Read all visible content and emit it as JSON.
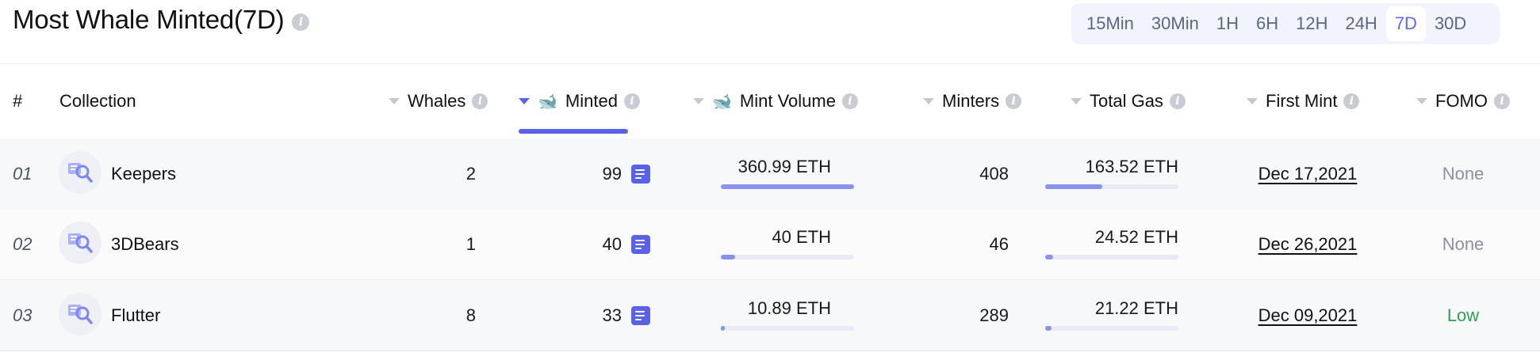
{
  "title": "Most Whale Minted(7D)",
  "time_filters": [
    "15Min",
    "30Min",
    "1H",
    "6H",
    "12H",
    "24H",
    "7D",
    "30D"
  ],
  "active_time_filter": "7D",
  "columns": {
    "rank": "#",
    "collection": "Collection",
    "whales": "Whales",
    "minted": "Minted",
    "mint_volume": "Mint Volume",
    "minters": "Minters",
    "total_gas": "Total Gas",
    "first_mint": "First Mint",
    "fomo": "FOMO"
  },
  "sorted_column": "Minted",
  "rows": [
    {
      "rank": "01",
      "collection": "Keepers",
      "whales": "2",
      "minted": "99",
      "mint_volume": "360.99 ETH",
      "mint_volume_fill": 1.0,
      "minters": "408",
      "total_gas": "163.52 ETH",
      "total_gas_fill": 0.43,
      "first_mint": "Dec 17,2021",
      "fomo": "None"
    },
    {
      "rank": "02",
      "collection": "3DBears",
      "whales": "1",
      "minted": "40",
      "mint_volume": "40 ETH",
      "mint_volume_fill": 0.11,
      "minters": "46",
      "total_gas": "24.52 ETH",
      "total_gas_fill": 0.06,
      "first_mint": "Dec 26,2021",
      "fomo": "None"
    },
    {
      "rank": "03",
      "collection": "Flutter",
      "whales": "8",
      "minted": "33",
      "mint_volume": "10.89 ETH",
      "mint_volume_fill": 0.03,
      "minters": "289",
      "total_gas": "21.22 ETH",
      "total_gas_fill": 0.05,
      "first_mint": "Dec 09,2021",
      "fomo": "Low"
    }
  ],
  "colors": {
    "accent": "#5a63e6",
    "fomo_none": "#8a90a0",
    "fomo_low": "#2e9e4f"
  }
}
